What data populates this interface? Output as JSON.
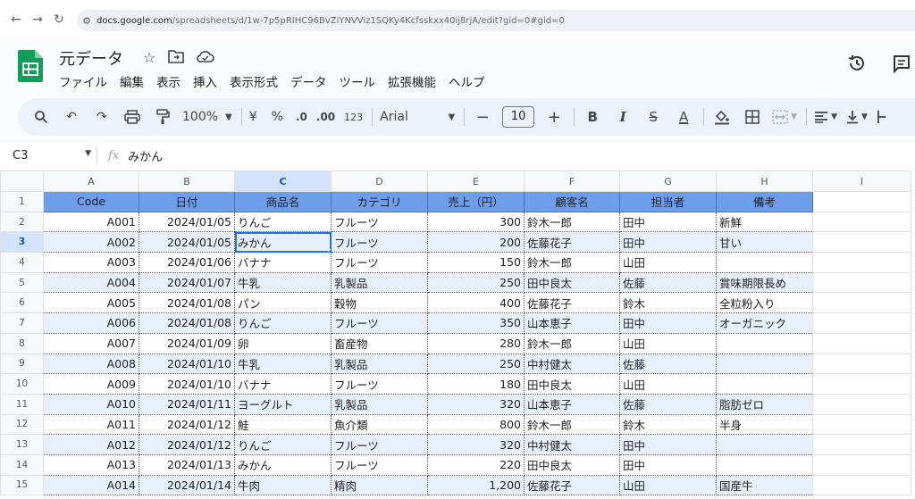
{
  "browser": {
    "host": "docs.google.com",
    "path": "/spreadsheets/d/1w-7p5pRIHC96BvZiYNVViz1SQKy4Kcfsskxx40ij8rjA/edit?gid=0#gid=0"
  },
  "doc": {
    "title": "元データ",
    "menu": [
      "ファイル",
      "編集",
      "表示",
      "挿入",
      "表示形式",
      "データ",
      "ツール",
      "拡張機能",
      "ヘルプ"
    ]
  },
  "toolbar": {
    "zoom": "100%",
    "currency": "¥",
    "percent": "%",
    "dec_decrease": ".0",
    "dec_increase": ".00",
    "number_format": "123",
    "font": "Arial",
    "font_size": "10",
    "minus": "−",
    "plus": "+",
    "bold": "B",
    "italic": "I",
    "strike": "S",
    "underline_a": "A"
  },
  "formula_bar": {
    "cell_ref": "C3",
    "value": "みかん"
  },
  "grid": {
    "columns": [
      "A",
      "B",
      "C",
      "D",
      "E",
      "F",
      "G",
      "H",
      "I"
    ],
    "selected_column": "C",
    "selected_row": 3,
    "header_row": [
      "Code",
      "日付",
      "商品名",
      "カテゴリ",
      "売上（円）",
      "顧客名",
      "担当者",
      "備考"
    ],
    "rows": [
      {
        "n": "2",
        "cells": [
          "A001",
          "2024/01/05",
          "りんご",
          "フルーツ",
          "300",
          "鈴木一郎",
          "田中",
          "新鮮"
        ]
      },
      {
        "n": "3",
        "cells": [
          "A002",
          "2024/01/05",
          "みかん",
          "フルーツ",
          "200",
          "佐藤花子",
          "田中",
          "甘い"
        ]
      },
      {
        "n": "4",
        "cells": [
          "A003",
          "2024/01/06",
          "バナナ",
          "フルーツ",
          "150",
          "鈴木一郎",
          "山田",
          ""
        ]
      },
      {
        "n": "5",
        "cells": [
          "A004",
          "2024/01/07",
          "牛乳",
          "乳製品",
          "250",
          "田中良太",
          "佐藤",
          "賞味期限長め"
        ]
      },
      {
        "n": "6",
        "cells": [
          "A005",
          "2024/01/08",
          "パン",
          "穀物",
          "400",
          "佐藤花子",
          "鈴木",
          "全粒粉入り"
        ]
      },
      {
        "n": "7",
        "cells": [
          "A006",
          "2024/01/08",
          "りんご",
          "フルーツ",
          "350",
          "山本恵子",
          "田中",
          "オーガニック"
        ]
      },
      {
        "n": "8",
        "cells": [
          "A007",
          "2024/01/09",
          "卵",
          "畜産物",
          "280",
          "鈴木一郎",
          "山田",
          ""
        ]
      },
      {
        "n": "9",
        "cells": [
          "A008",
          "2024/01/10",
          "牛乳",
          "乳製品",
          "250",
          "中村健太",
          "佐藤",
          ""
        ]
      },
      {
        "n": "10",
        "cells": [
          "A009",
          "2024/01/10",
          "バナナ",
          "フルーツ",
          "180",
          "田中良太",
          "山田",
          ""
        ]
      },
      {
        "n": "11",
        "cells": [
          "A010",
          "2024/01/11",
          "ヨーグルト",
          "乳製品",
          "320",
          "山本恵子",
          "佐藤",
          "脂肪ゼロ"
        ]
      },
      {
        "n": "12",
        "cells": [
          "A011",
          "2024/01/12",
          "鮭",
          "魚介類",
          "800",
          "鈴木一郎",
          "鈴木",
          "半身"
        ]
      },
      {
        "n": "13",
        "cells": [
          "A012",
          "2024/01/12",
          "りんご",
          "フルーツ",
          "320",
          "中村健太",
          "田中",
          ""
        ]
      },
      {
        "n": "14",
        "cells": [
          "A013",
          "2024/01/13",
          "みかん",
          "フルーツ",
          "220",
          "田中良太",
          "田中",
          ""
        ]
      },
      {
        "n": "15",
        "cells": [
          "A014",
          "2024/01/14",
          "牛肉",
          "精肉",
          "1,200",
          "佐藤花子",
          "山田",
          "国産牛"
        ]
      }
    ]
  },
  "colors": {
    "header_fill": "#6d9eeb",
    "band_fill": "#e8f0fe",
    "selection": "#1a73e8"
  }
}
